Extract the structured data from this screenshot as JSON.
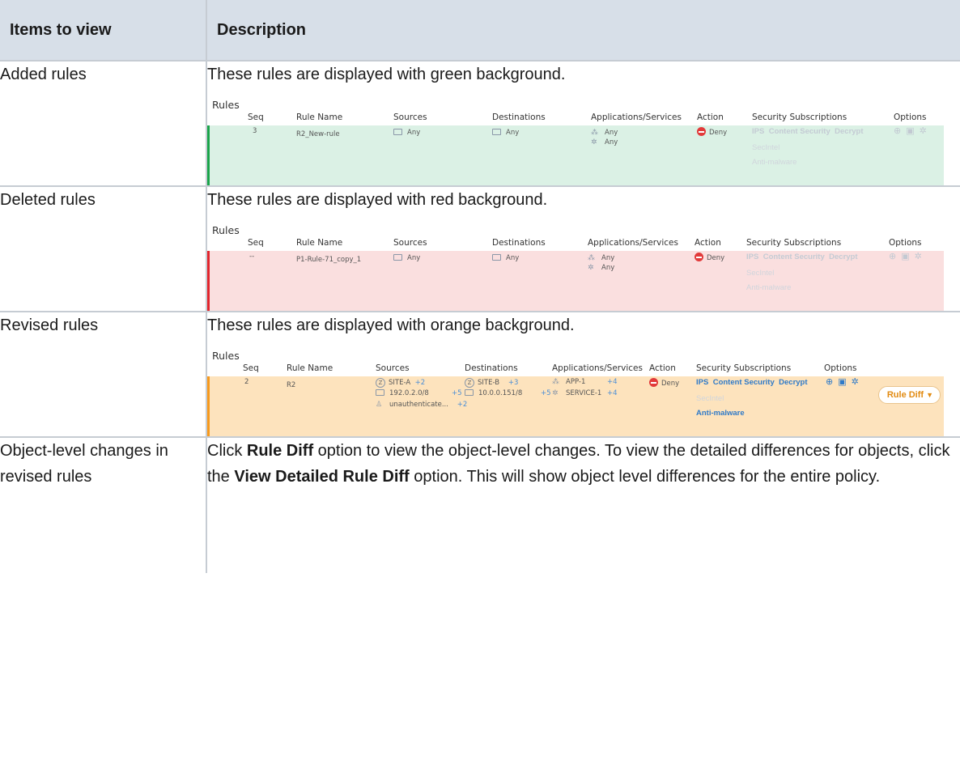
{
  "table": {
    "headers": [
      "Items to view",
      "Description"
    ]
  },
  "cols": {
    "seq": "Seq",
    "rule_name": "Rule Name",
    "sources": "Sources",
    "destinations": "Destinations",
    "apps": "Applications/Services",
    "action": "Action",
    "subs": "Security Subscriptions",
    "options": "Options"
  },
  "rules_title": "Rules",
  "rows": [
    {
      "item": "Added rules",
      "description": "These rules are displayed with green background.",
      "rule": {
        "seq": "3",
        "name": "R2_New-rule",
        "source": "Any",
        "destination": "Any",
        "app": "Any",
        "service": "Any",
        "action": "Deny",
        "sub_ips": "IPS",
        "sub_cs": "Content Security",
        "sub_decrypt": "Decrypt",
        "sub_secintel": "SecIntel",
        "sub_am": "Anti-malware"
      }
    },
    {
      "item": "Deleted rules",
      "description": "These rules are displayed with red background.",
      "rule": {
        "seq": "--",
        "name": "P1-Rule-71_copy_1",
        "source": "Any",
        "destination": "Any",
        "app": "Any",
        "service": "Any",
        "action": "Deny",
        "sub_ips": "IPS",
        "sub_cs": "Content Security",
        "sub_decrypt": "Decrypt",
        "sub_secintel": "SecIntel",
        "sub_am": "Anti-malware"
      }
    },
    {
      "item": "Revised rules",
      "description": "These rules are displayed with orange background.",
      "rule": {
        "seq": "2",
        "name": "R2",
        "src_zone": "SITE-A",
        "src_zone_more": "+2",
        "src_addr": "192.0.2.0/8",
        "src_addr_more": "+5",
        "src_user": "unauthenticate...",
        "src_user_more": "+2",
        "dst_zone": "SITE-B",
        "dst_zone_more": "+3",
        "dst_addr": "10.0.0.151/8",
        "dst_addr_more": "+5",
        "app": "APP-1",
        "app_more": "+4",
        "service": "SERVICE-1",
        "service_more": "+4",
        "action": "Deny",
        "sub_ips": "IPS",
        "sub_cs": "Content Security",
        "sub_decrypt": "Decrypt",
        "sub_secintel": "SecIntel",
        "sub_am": "Anti-malware",
        "rule_diff": "Rule Diff"
      }
    },
    {
      "item": "Object-level changes in revised rules",
      "desc_1": "Click ",
      "desc_b1": "Rule Diff",
      "desc_2": " option to view the object-level changes. To view the detailed differences for objects, click the ",
      "desc_b2": "View Detailed Rule Diff",
      "desc_3": " option. This will show object level differences for the entire policy."
    }
  ],
  "icons": {
    "address": "monitor-icon",
    "application": "app-icon",
    "service": "gear-icon",
    "deny": "deny-icon",
    "zone": "zone-icon",
    "user": "user-icon",
    "options": [
      "arrow-circle-icon",
      "calendar-icon",
      "gear-icon"
    ]
  },
  "colors": {
    "header_bg": "#d7dfe8",
    "added_bg": "#dbf1e5",
    "added_bar": "#1aa44a",
    "deleted_bg": "#fadfdf",
    "deleted_bar": "#e2262e",
    "revised_bg": "#fde3bd",
    "revised_bar": "#f79a1e",
    "deny": "#e23a3a",
    "subscription_active": "#2f7ac8"
  }
}
